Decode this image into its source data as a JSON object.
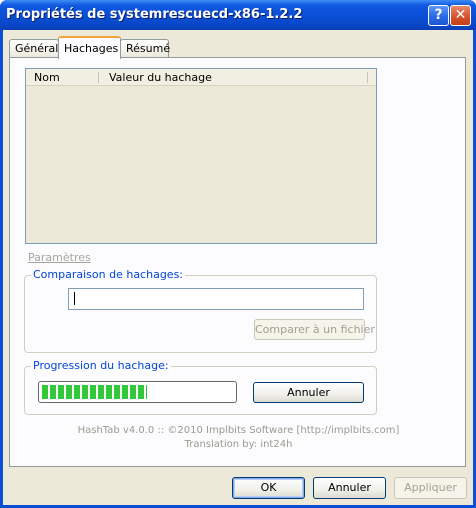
{
  "window": {
    "title": "Propriétés de systemrescuecd-x86-1.2.2",
    "help_glyph": "?",
    "close_glyph": "✕"
  },
  "tabs": [
    {
      "label": "Général",
      "active": false
    },
    {
      "label": "Hachages",
      "active": true
    },
    {
      "label": "Résumé",
      "active": false
    }
  ],
  "hash_list": {
    "columns": [
      "Nom",
      "Valeur du hachage"
    ],
    "rows": []
  },
  "params_link": "Paramètres",
  "compare": {
    "group_label": "Comparaison de hachages:",
    "input_value": "",
    "compare_file_button": "Comparer à un fichier"
  },
  "progress": {
    "group_label": "Progression du hachage:",
    "percent": 55,
    "cancel_button": "Annuler"
  },
  "about": {
    "line1": "HashTab v4.0.0 :: ©2010 Implbits Software [http://implbits.com]",
    "line2": "Translation by: int24h"
  },
  "dialog_buttons": {
    "ok": "OK",
    "cancel": "Annuler",
    "apply": "Appliquer"
  },
  "colors": {
    "titlebar": "#0a4ed4",
    "group_label": "#0046d5",
    "progress_fill": "#32c83a",
    "active_tab_accent": "#f7a43d"
  }
}
